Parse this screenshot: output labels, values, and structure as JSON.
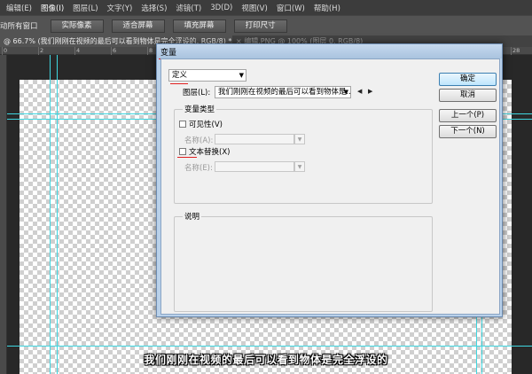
{
  "menubar": {
    "items": [
      {
        "label": "编辑(E)"
      },
      {
        "label": "图像(I)",
        "active": true
      },
      {
        "label": "图层(L)"
      },
      {
        "label": "文字(Y)"
      },
      {
        "label": "选择(S)"
      },
      {
        "label": "滤镜(T)"
      },
      {
        "label": "3D(D)"
      },
      {
        "label": "视图(V)"
      },
      {
        "label": "窗口(W)"
      },
      {
        "label": "帮助(H)"
      }
    ]
  },
  "options_bar": {
    "check_label": "动所有窗口",
    "buttons": [
      "实际像素",
      "适合屏幕",
      "填充屏幕",
      "打印尺寸"
    ]
  },
  "doc_tabs": [
    {
      "label": "@ 66.7% (我们刚刚在视频的最后可以看到物体是完全浮设的, RGB/8) *",
      "active": true
    },
    {
      "label": "× 编辑.PNG @ 100% (图层 0, RGB/8)",
      "active": false
    }
  ],
  "ruler_numbers": [
    "0",
    "2",
    "4",
    "6",
    "8",
    "10",
    "12",
    "14",
    "16",
    "18",
    "20",
    "22",
    "24",
    "26",
    "28"
  ],
  "subtitle": "我们刚刚在视频的最后可以看到物体是完全浮设的",
  "dialog": {
    "title": "变量",
    "definition_select": "定义",
    "layer_label": "图层(L):",
    "layer_value": "我们刚刚在视频的最后可以看到物体是...",
    "var_type_legend": "变量类型",
    "visibility": {
      "label": "可见性(V)",
      "name_label": "名称(A):",
      "checked": false
    },
    "text_replace": {
      "label": "文本替换(X)",
      "name_label": "名称(E):",
      "checked": false
    },
    "description_legend": "说明",
    "buttons": {
      "ok": "确定",
      "cancel": "取消",
      "prev": "上一个(P)",
      "next": "下一个(N)"
    }
  },
  "colors": {
    "guide": "#3fd6e0",
    "dialog_frame": "#b9d1ea",
    "highlight_underline": "#e02020"
  }
}
